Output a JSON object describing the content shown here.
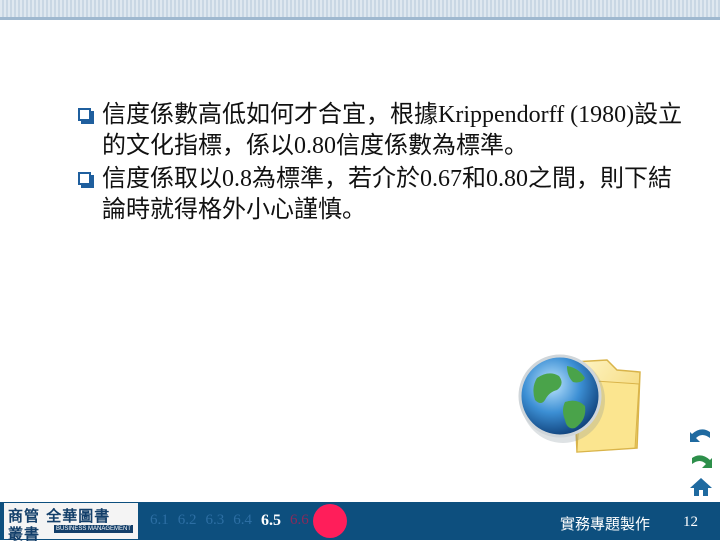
{
  "slide": {
    "bullets": [
      "信度係數高低如何才合宜，根據Krippendorff (1980)設立的文化指標，係以0.80信度係數為標準。",
      "信度係取以0.8為標準，若介於0.67和0.80之間，則下結論時就得格外小心謹慎。"
    ]
  },
  "footer": {
    "logo_cn_top": "商管 全華圖書",
    "logo_cn_bottom": "叢書",
    "logo_en": "BUSINESS MANAGEMENT",
    "chapters": [
      "6.1",
      "6.2",
      "6.3",
      "6.4",
      "6.5",
      "6.6"
    ],
    "current_chapter": "6.5",
    "title": "實務專題製作",
    "page_number": "12"
  },
  "colors": {
    "footer_bg": "#0d4f7e",
    "accent": "#1f5f9e",
    "highlight": "#ff1e5a"
  },
  "icons": [
    "bullet-square-icon",
    "globe-folder-icon",
    "back-arrow-icon",
    "forward-arrow-icon",
    "home-icon"
  ]
}
